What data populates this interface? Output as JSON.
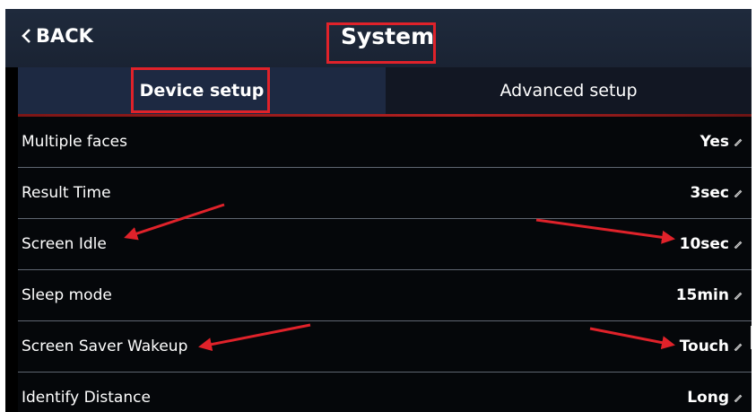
{
  "header": {
    "back_label": "BACK",
    "title": "System"
  },
  "tabs": [
    {
      "label": "Device setup",
      "active": true
    },
    {
      "label": "Advanced setup",
      "active": false
    }
  ],
  "settings": [
    {
      "label": "Multiple faces",
      "value": "Yes"
    },
    {
      "label": "Result Time",
      "value": "3sec"
    },
    {
      "label": "Screen Idle",
      "value": "10sec"
    },
    {
      "label": "Sleep mode",
      "value": "15min"
    },
    {
      "label": "Screen Saver Wakeup",
      "value": "Touch"
    },
    {
      "label": "Identify Distance",
      "value": "Long"
    }
  ],
  "icons": {
    "back": "chevron-left-icon",
    "edit": "pencil-icon"
  },
  "colors": {
    "accent": "#e0222a",
    "active_tab": "#1d2942",
    "topbar": "#1f2a3c",
    "row_bg": "#05070a"
  }
}
